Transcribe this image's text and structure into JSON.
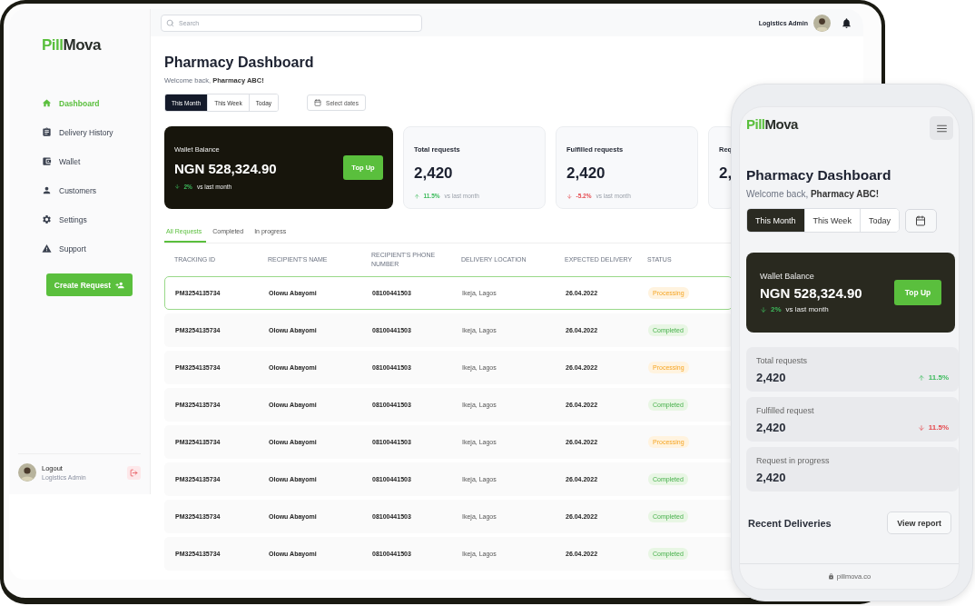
{
  "desktop": {
    "logo": {
      "accent": "Pill",
      "rest": "Mova"
    },
    "search": {
      "placeholder": "Search"
    },
    "header": {
      "user_name": "Logistics Admin"
    },
    "sidebar": {
      "items": [
        {
          "label": "Dashboard",
          "selected": true
        },
        {
          "label": "Delivery History",
          "selected": false
        },
        {
          "label": "Wallet",
          "selected": false
        },
        {
          "label": "Customers",
          "selected": false
        },
        {
          "label": "Settings",
          "selected": false
        },
        {
          "label": "Support",
          "selected": false
        }
      ],
      "create_button": "Create Request",
      "user": {
        "name": "Logout",
        "role": "Logistics Admin"
      }
    },
    "page": {
      "title": "Pharmacy Dashboard",
      "welcome": "Welcome back, **Pharmacy ABC!**"
    },
    "periods": [
      {
        "label": "This Month",
        "selected": true
      },
      {
        "label": "This Week",
        "selected": false
      },
      {
        "label": "Today",
        "selected": false
      }
    ],
    "date_button": "Select dates",
    "wallet": {
      "title": "Wallet Balance",
      "amount": "NGN 528,324.90",
      "change": "2%",
      "note": "vs last month",
      "rising": false,
      "favourable": true,
      "button": "Top Up"
    },
    "stats": [
      {
        "title": "Total requests",
        "value": "2,420",
        "change": "11.5%",
        "note": "vs last month",
        "rising": true,
        "favourable": true
      },
      {
        "title": "Fulfilled requests",
        "value": "2,420",
        "change": "-5.2%",
        "note": "vs last month",
        "rising": false,
        "favourable": false
      },
      {
        "title": "Req",
        "value": "2,"
      }
    ],
    "tabs": [
      {
        "label": "All Requests",
        "selected": true
      },
      {
        "label": "Completed",
        "selected": false
      },
      {
        "label": "In progress",
        "selected": false
      }
    ],
    "table": {
      "columns": [
        "TRACKING ID",
        "RECIPIENT'S NAME",
        "RECIPIENT'S PHONE NUMBER",
        "DELIVERY LOCATION",
        "EXPECTED DELIVERY",
        "STATUS"
      ],
      "rows": [
        {
          "cells": [
            "PM3254135734",
            "Olowu Abayomi",
            "08100441503",
            "Ikeja, Lagos",
            "26.04.2022"
          ],
          "status": {
            "label": "Processing",
            "kind": "processing"
          },
          "selected": true
        },
        {
          "cells": [
            "PM3254135734",
            "Olowu Abayomi",
            "08100441503",
            "Ikeja, Lagos",
            "26.04.2022"
          ],
          "status": {
            "label": "Completed",
            "kind": "completed"
          },
          "selected": false
        },
        {
          "cells": [
            "PM3254135734",
            "Olowu Abayomi",
            "08100441503",
            "Ikeja, Lagos",
            "26.04.2022"
          ],
          "status": {
            "label": "Processing",
            "kind": "processing"
          },
          "selected": false
        },
        {
          "cells": [
            "PM3254135734",
            "Olowu Abayomi",
            "08100441503",
            "Ikeja, Lagos",
            "26.04.2022"
          ],
          "status": {
            "label": "Completed",
            "kind": "completed"
          },
          "selected": false
        },
        {
          "cells": [
            "PM3254135734",
            "Olowu Abayomi",
            "08100441503",
            "Ikeja, Lagos",
            "26.04.2022"
          ],
          "status": {
            "label": "Processing",
            "kind": "processing"
          },
          "selected": false
        },
        {
          "cells": [
            "PM3254135734",
            "Olowu Abayomi",
            "08100441503",
            "Ikeja, Lagos",
            "26.04.2022"
          ],
          "status": {
            "label": "Completed",
            "kind": "completed"
          },
          "selected": false
        },
        {
          "cells": [
            "PM3254135734",
            "Olowu Abayomi",
            "08100441503",
            "Ikeja, Lagos",
            "26.04.2022"
          ],
          "status": {
            "label": "Completed",
            "kind": "completed"
          },
          "selected": false
        },
        {
          "cells": [
            "PM3254135734",
            "Olowu Abayomi",
            "08100441503",
            "Ikeja, Lagos",
            "26.04.2022"
          ],
          "status": {
            "label": "Completed",
            "kind": "completed"
          },
          "selected": false
        }
      ]
    }
  },
  "phone": {
    "logo": {
      "accent": "Pill",
      "rest": "Mova"
    },
    "page": {
      "title": "Pharmacy Dashboard",
      "welcome": "Welcome back, **Pharmacy ABC!**"
    },
    "periods": [
      {
        "label": "This Month",
        "selected": true
      },
      {
        "label": "This Week",
        "selected": false
      },
      {
        "label": "Today",
        "selected": false
      }
    ],
    "wallet": {
      "title": "Wallet Balance",
      "amount": "NGN 528,324.90",
      "change": "2%",
      "note": "vs last month",
      "rising": false,
      "favourable": true,
      "button": "Top Up"
    },
    "stats": [
      {
        "title": "Total requests",
        "value": "2,420",
        "change": "11.5%",
        "rising": true,
        "favourable": true
      },
      {
        "title": "Fulfilled request",
        "value": "2,420",
        "change": "11.5%",
        "rising": false,
        "favourable": false
      },
      {
        "title": "Request in progress",
        "value": "2,420"
      }
    ],
    "section_title": "Recent Deliveries",
    "report_button": "View report",
    "url": "pillmova.co"
  }
}
